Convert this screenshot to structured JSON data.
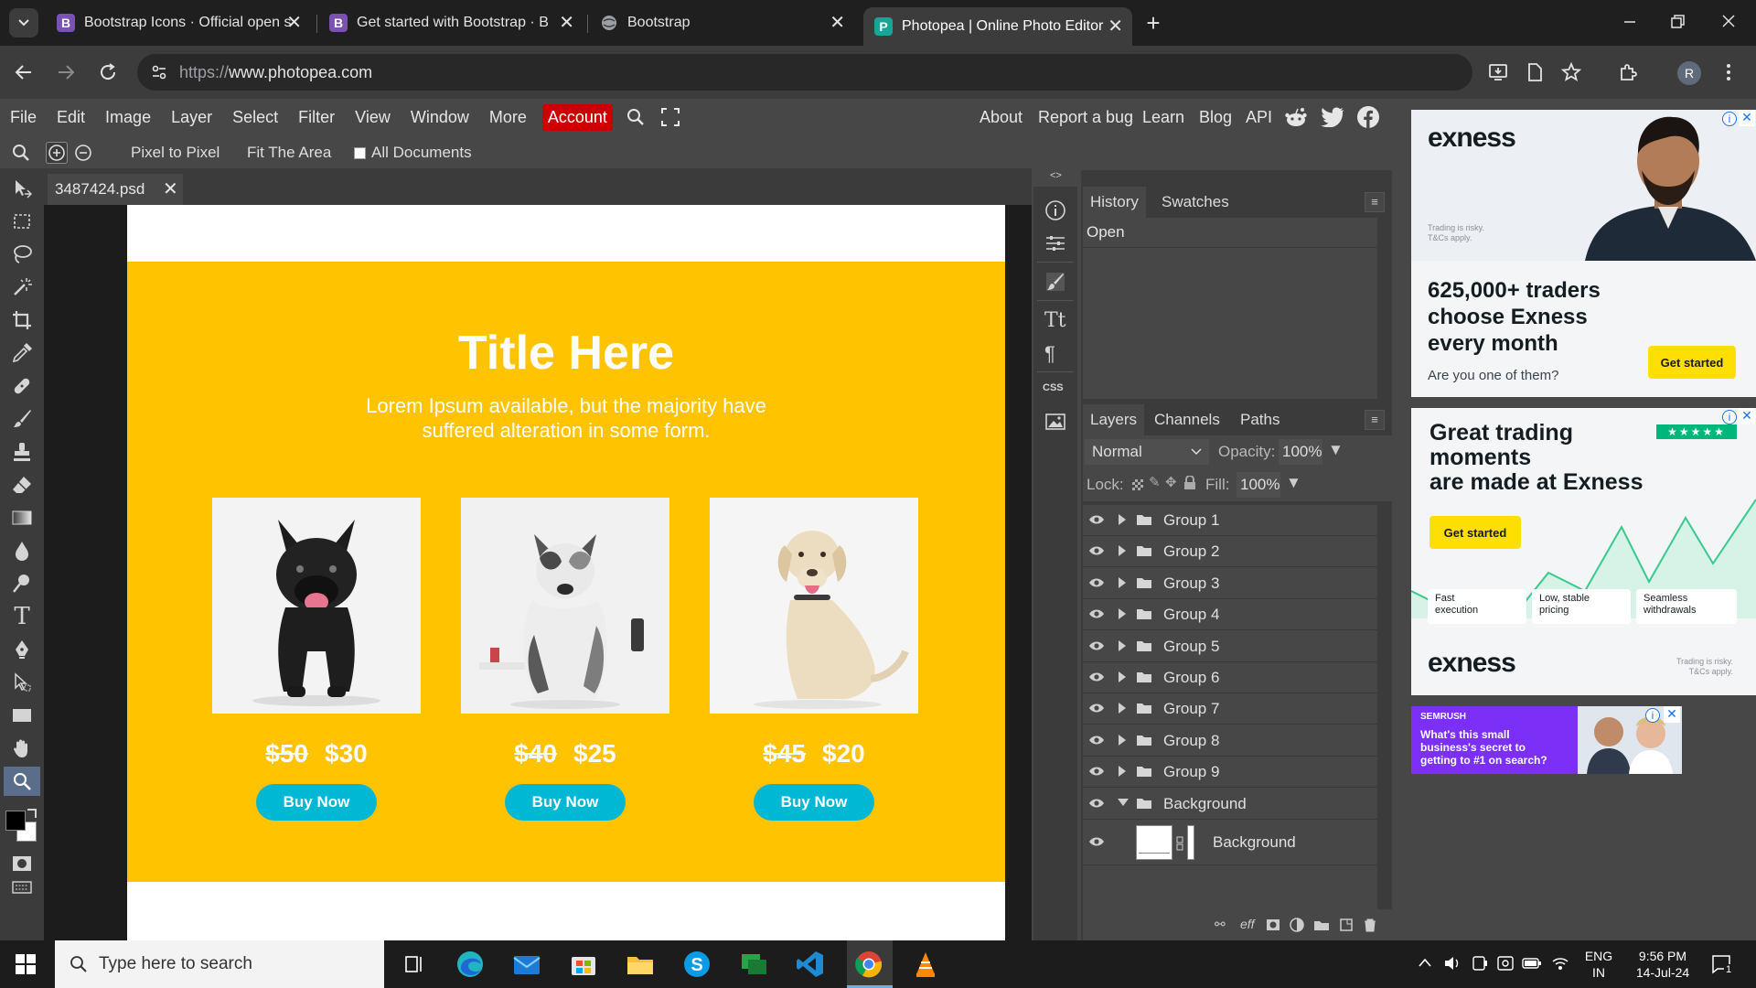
{
  "browser": {
    "tabs": [
      {
        "label": "Bootstrap Icons · Official open s",
        "favicon": "B",
        "color": "#7952b3"
      },
      {
        "label": "Get started with Bootstrap · Boo",
        "favicon": "B",
        "color": "#7952b3"
      },
      {
        "label": "Bootstrap",
        "favicon": "globe-icon",
        "color": "#5f6368"
      },
      {
        "label": "Photopea | Online Photo Editor",
        "favicon": "P",
        "color": "#18a497"
      }
    ],
    "url_prefix": "https://",
    "url_host": "www.photopea.com",
    "profile_initial": "R"
  },
  "menu": {
    "items": [
      "File",
      "Edit",
      "Image",
      "Layer",
      "Select",
      "Filter",
      "View",
      "Window",
      "More"
    ],
    "account": "Account",
    "right_links": [
      "About",
      "Report a bug",
      "Learn",
      "Blog",
      "API"
    ]
  },
  "tool_options": {
    "pixel_to_pixel": "Pixel to Pixel",
    "fit_area": "Fit The Area",
    "all_documents": "All Documents"
  },
  "document": {
    "tab_name": "3487424.psd",
    "title": "Title Here",
    "subtitle_line1": "Lorem Ipsum available, but the majority have",
    "subtitle_line2": "suffered alteration in some form.",
    "products": [
      {
        "old_price": "$50",
        "new_price": "$30",
        "button": "Buy Now",
        "dog": "french-bulldog"
      },
      {
        "old_price": "$40",
        "new_price": "$25",
        "button": "Buy Now",
        "dog": "australian-shepherd"
      },
      {
        "old_price": "$45",
        "new_price": "$20",
        "button": "Buy Now",
        "dog": "labrador"
      }
    ],
    "banner_color": "#ffc300",
    "button_color": "#00b7d4"
  },
  "panels": {
    "history_tabs": [
      "History",
      "Swatches"
    ],
    "history_items": [
      "Open"
    ],
    "layer_tabs": [
      "Layers",
      "Channels",
      "Paths"
    ],
    "blend_mode": "Normal",
    "opacity_label": "Opacity:",
    "opacity": "100%",
    "lock_label": "Lock:",
    "fill_label": "Fill:",
    "fill": "100%",
    "layers": [
      "Group 1",
      "Group 2",
      "Group 3",
      "Group 4",
      "Group 5",
      "Group 6",
      "Group 7",
      "Group 8",
      "Group 9",
      "Background"
    ],
    "sublayer": "Background"
  },
  "ads": {
    "ad1_brand": "exness",
    "ad1_headline_1": "625,000+ traders",
    "ad1_headline_2": "choose Exness",
    "ad1_headline_3": "every month",
    "ad1_question": "Are you one of them?",
    "ad1_cta": "Get started",
    "ad1_risk_1": "Trading is risky.",
    "ad1_risk_2": "T&Cs apply.",
    "ad2_headline_1": "Great trading",
    "ad2_headline_2": "moments",
    "ad2_headline_3": "are made at Exness",
    "ad2_cta": "Get started",
    "ad2_features": [
      [
        "Fast",
        "execution"
      ],
      [
        "Low, stable",
        "pricing"
      ],
      [
        "Seamless",
        "withdrawals"
      ]
    ],
    "ad2_brand": "exness",
    "ad2_risk_1": "Trading is risky.",
    "ad2_risk_2": "T&Cs apply.",
    "ad3_brand": "SEMRUSH",
    "ad3_text_1": "What's this small",
    "ad3_text_2": "business's secret to",
    "ad3_text_3": "getting to #1 on search?"
  },
  "taskbar": {
    "search_placeholder": "Type here to search",
    "lang_1": "ENG",
    "lang_2": "IN",
    "time": "9:56 PM",
    "date": "14-Jul-24",
    "notifications": "1"
  }
}
